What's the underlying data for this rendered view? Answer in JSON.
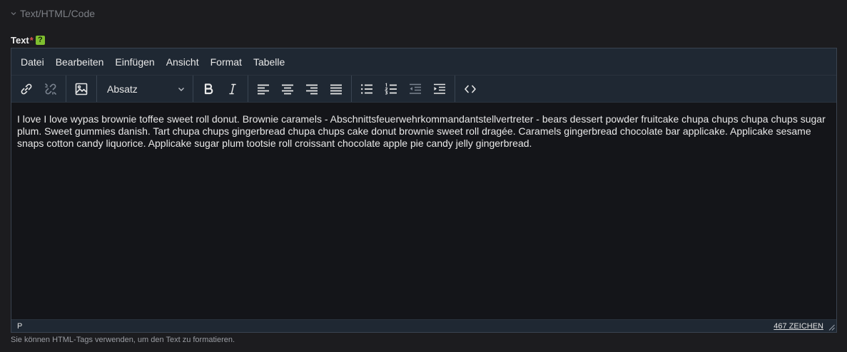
{
  "section": {
    "title": "Text/HTML/Code"
  },
  "field": {
    "label": "Text",
    "required_mark": "*",
    "help_glyph": "?"
  },
  "menubar": {
    "items": [
      "Datei",
      "Bearbeiten",
      "Einfügen",
      "Ansicht",
      "Format",
      "Tabelle"
    ]
  },
  "toolbar": {
    "block_format": "Absatz",
    "icons": [
      "link-icon",
      "unlink-icon",
      "image-icon",
      "bold-icon",
      "italic-icon",
      "align-left-icon",
      "align-center-icon",
      "align-right-icon",
      "align-justify-icon",
      "bullet-list-icon",
      "numbered-list-icon",
      "outdent-icon",
      "indent-icon",
      "source-code-icon"
    ]
  },
  "content": {
    "text": "I love I love wypas brownie toffee sweet roll donut. Brownie caramels - Abschnittsfeuerwehrkommandantstellvertreter - bears dessert powder fruitcake chupa chups chupa chups sugar plum. Sweet gummies danish. Tart chupa chups gingerbread chupa chups cake donut brownie sweet roll dragée. Caramels gingerbread chocolate bar applicake. Applicake sesame snaps cotton candy liquorice. Applicake sugar plum tootsie roll croissant chocolate apple pie candy jelly gingerbread."
  },
  "statusbar": {
    "path": "P",
    "char_count": "467 ZEICHEN"
  },
  "hint": "Sie können HTML-Tags verwenden, um den Text zu formatieren.",
  "colors": {
    "background": "#1c1c1f",
    "toolbar": "#1f2833",
    "editor": "#141519",
    "help": "#7fbf2f",
    "required": "#d9534f"
  }
}
